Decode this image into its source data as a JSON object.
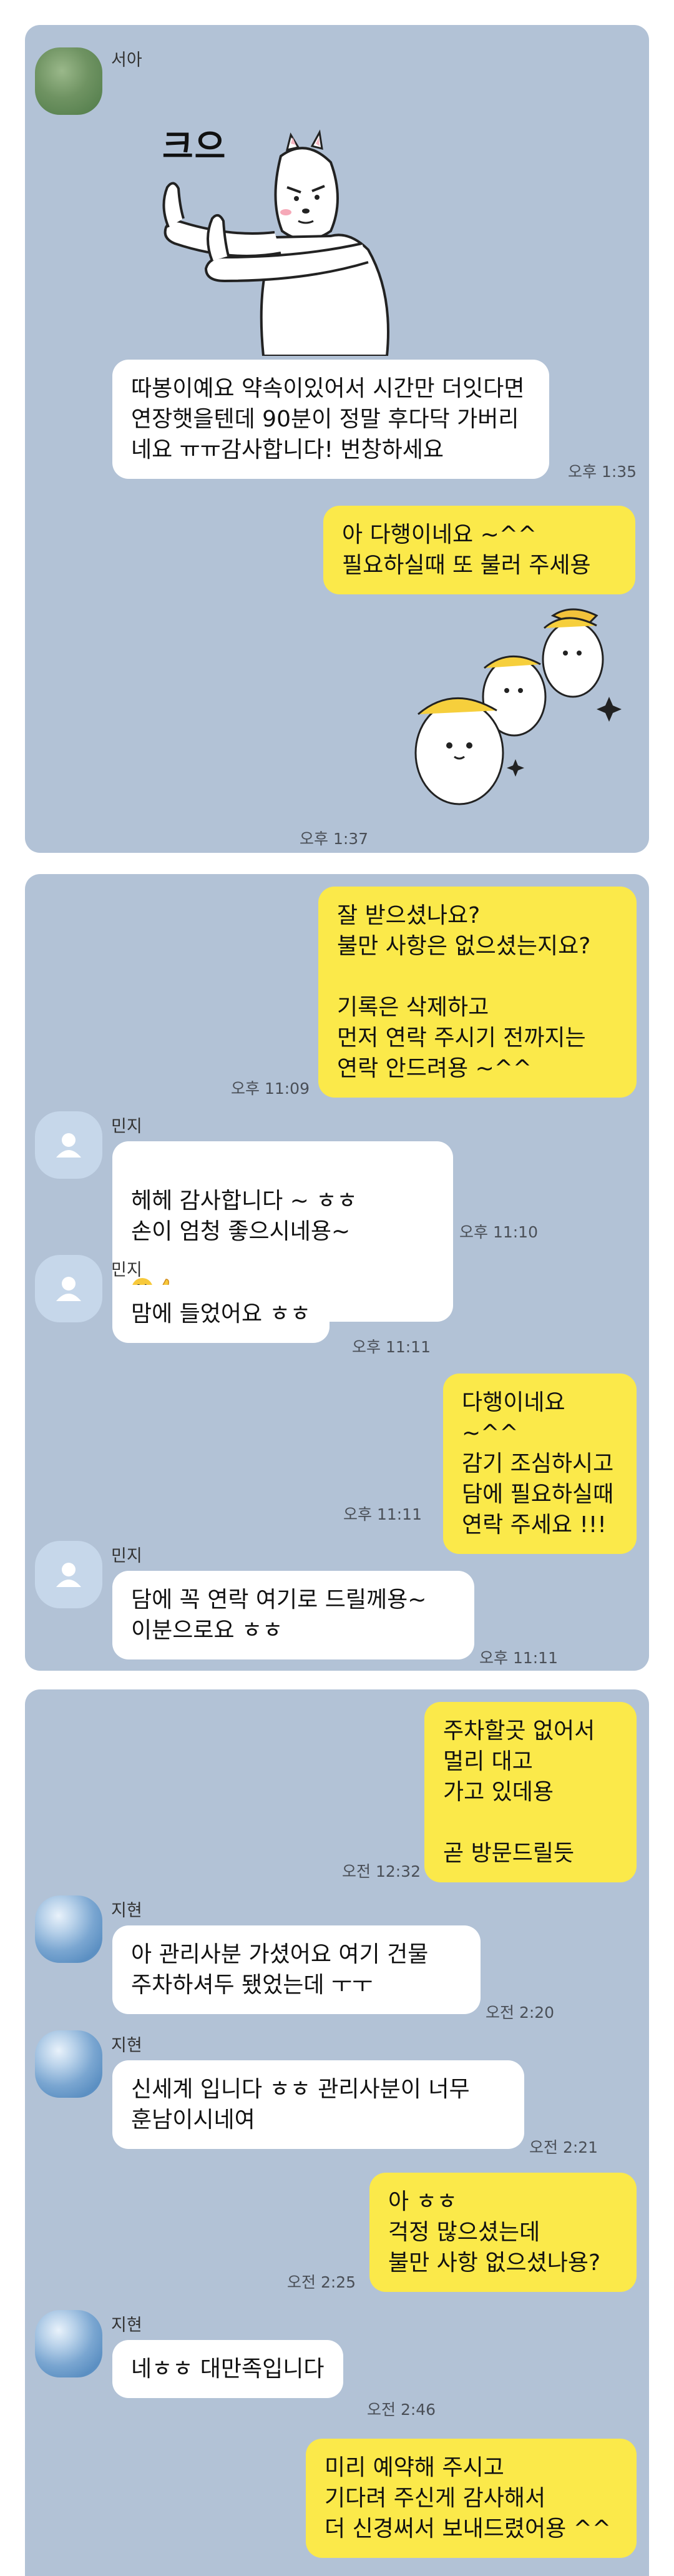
{
  "colors": {
    "chat_background": "#b2c2d6",
    "incoming_bubble": "#ffffff",
    "outgoing_bubble": "#fbe94a",
    "page_background": "#ffffff"
  },
  "panel1": {
    "sender": "서아",
    "sticker1_text": "크으",
    "msg1": "따봉이예요 약속이있어서 시간만 더잇다면 연장햇을텐데 90분이 정말 후다닥 가버리네요 ㅠㅠ감사합니다! 번창하세요",
    "time1": "오후 1:35",
    "msg2": "아 다행이네요 ~^^\n필요하실때 또 불러 주세용",
    "time2": "오후 1:37"
  },
  "panel2": {
    "msg1": "잘 받으셨나요?\n불만 사항은 없으셨는지요?\n\n기록은 삭제하고\n먼저 연락 주시기 전까지는\n연락 안드려용 ~^^",
    "time1": "오후 11:09",
    "sender": "민지",
    "msg2": "헤헤 감사합니다 ~ ㅎㅎ\n손이 엄청 좋으시네용~",
    "time2": "오후 11:10",
    "msg3": "맘에 들었어요 ㅎㅎ",
    "time3": "오후 11:11",
    "msg4": "다행이네요 ~^^\n감기 조심하시고\n담에 필요하실때\n연락 주세요 !!!",
    "time4": "오후 11:11",
    "msg5": "담에 꼭 연락 여기로 드릴께용~\n이분으로요 ㅎㅎ",
    "time5": "오후 11:11"
  },
  "panel3": {
    "msg1": "주차할곳 없어서\n멀리 대고\n가고 있데용\n\n곧 방문드릴듯",
    "time1": "오전 12:32",
    "sender": "지현",
    "msg2": "아 관리사분 가셨어요 여기 건물\n주차하셔두 됐었는데 ㅜㅜ",
    "time2": "오전 2:20",
    "msg3": "신세계 입니다 ㅎㅎ 관리사분이 너무\n훈남이시네여",
    "time3": "오전 2:21",
    "msg4": "아 ㅎㅎ\n걱정 많으셨는데\n불만 사항 없으셨나용?",
    "time4": "오전 2:25",
    "msg5": "네ㅎㅎ 대만족입니다",
    "time5": "오전 2:46",
    "msg6": "미리 예약해 주시고\n기다려 주신게 감사해서\n더 신경써서 보내드렸어용 ^^"
  }
}
